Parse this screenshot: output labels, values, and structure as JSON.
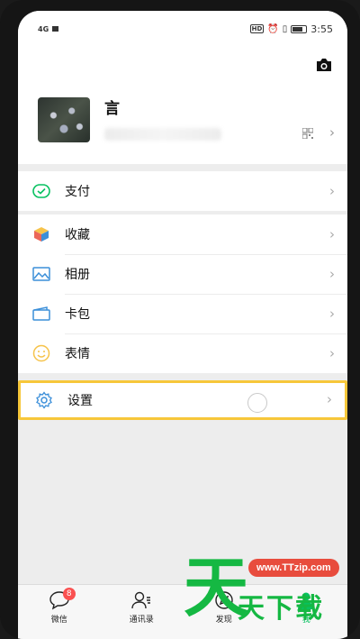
{
  "status_bar": {
    "signal": "4G",
    "time": "3:55"
  },
  "profile": {
    "name": "言"
  },
  "menu": {
    "pay": {
      "label": "支付",
      "icon": "wechat-pay-icon"
    },
    "favorites": {
      "label": "收藏",
      "icon": "cube-icon"
    },
    "album": {
      "label": "相册",
      "icon": "photo-icon"
    },
    "cards": {
      "label": "卡包",
      "icon": "wallet-icon"
    },
    "stickers": {
      "label": "表情",
      "icon": "smiley-icon"
    },
    "settings": {
      "label": "设置",
      "icon": "gear-icon"
    }
  },
  "tabbar": {
    "tabs": [
      {
        "label": "微信",
        "icon": "chat-bubble-icon",
        "badge": "8"
      },
      {
        "label": "通讯录",
        "icon": "contacts-icon"
      },
      {
        "label": "发现",
        "icon": "compass-icon"
      },
      {
        "label": "我",
        "icon": "person-icon",
        "active": true
      }
    ]
  },
  "watermark": {
    "url": "www.TTzip.com",
    "big_char": "天",
    "text": "天下载"
  },
  "colors": {
    "accent_green": "#07c160",
    "highlight_border": "#f7c73a",
    "badge_red": "#fa5151",
    "watermark_green": "#15b843",
    "watermark_red": "#e84c3d"
  }
}
